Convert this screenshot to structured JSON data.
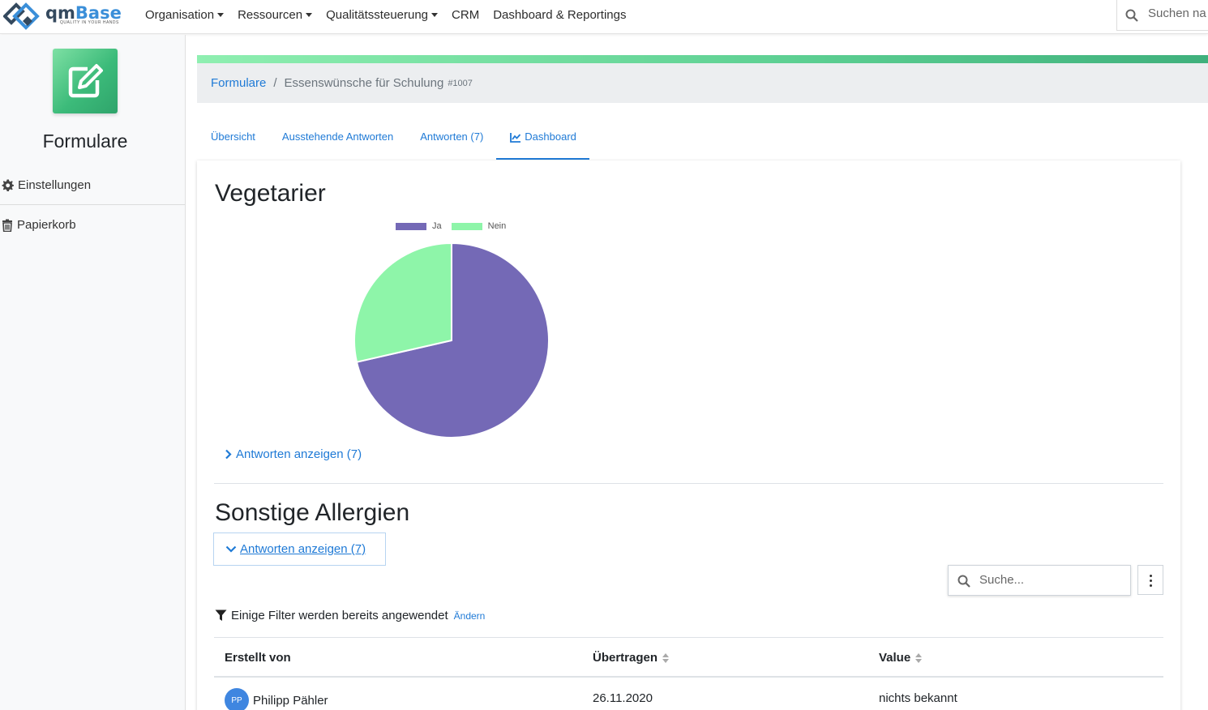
{
  "header": {
    "logo_main": "qm",
    "logo_accent": "Base",
    "logo_tagline": "QUALITY IN YOUR HANDS",
    "menu": [
      {
        "label": "Organisation",
        "dropdown": true
      },
      {
        "label": "Ressourcen",
        "dropdown": true
      },
      {
        "label": "Qualitätssteuerung",
        "dropdown": true
      },
      {
        "label": "CRM",
        "dropdown": false
      },
      {
        "label": "Dashboard & Reportings",
        "dropdown": false
      }
    ],
    "search_placeholder": "Suchen na"
  },
  "sidebar": {
    "title": "Formulare",
    "links": [
      {
        "label": "Einstellungen",
        "icon": "gear-icon"
      },
      {
        "label": "Papierkorb",
        "icon": "trash-icon"
      }
    ]
  },
  "breadcrumb": {
    "root": "Formulare",
    "separator": "/",
    "current": "Essenswünsche für Schulung",
    "id": "#1007"
  },
  "tabs": [
    {
      "label": "Übersicht",
      "active": false
    },
    {
      "label": "Ausstehende Antworten",
      "active": false
    },
    {
      "label": "Antworten (7)",
      "active": false
    },
    {
      "label": "Dashboard",
      "active": true,
      "icon": "chart-line-icon"
    }
  ],
  "sections": {
    "vegetarier": {
      "title": "Vegetarier",
      "show_answers": "Antworten anzeigen (7)"
    },
    "allergien": {
      "title": "Sonstige Allergien",
      "show_answers": "Antworten anzeigen (7)",
      "search_placeholder": "Suche...",
      "filter_note": "Einige Filter werden bereits angewendet",
      "filter_change": "Ändern",
      "table": {
        "columns": [
          "Erstellt von",
          "Übertragen",
          "Value"
        ],
        "rows": [
          {
            "initials": "PP",
            "creator": "Philipp Pähler",
            "date": "26.11.2020",
            "value": "nichts bekannt"
          }
        ]
      }
    }
  },
  "chart_data": {
    "type": "pie",
    "categories": [
      "Ja",
      "Nein"
    ],
    "values": [
      5,
      2
    ],
    "colors": [
      "#7469b6",
      "#8ef5a9"
    ],
    "legend": "top"
  }
}
